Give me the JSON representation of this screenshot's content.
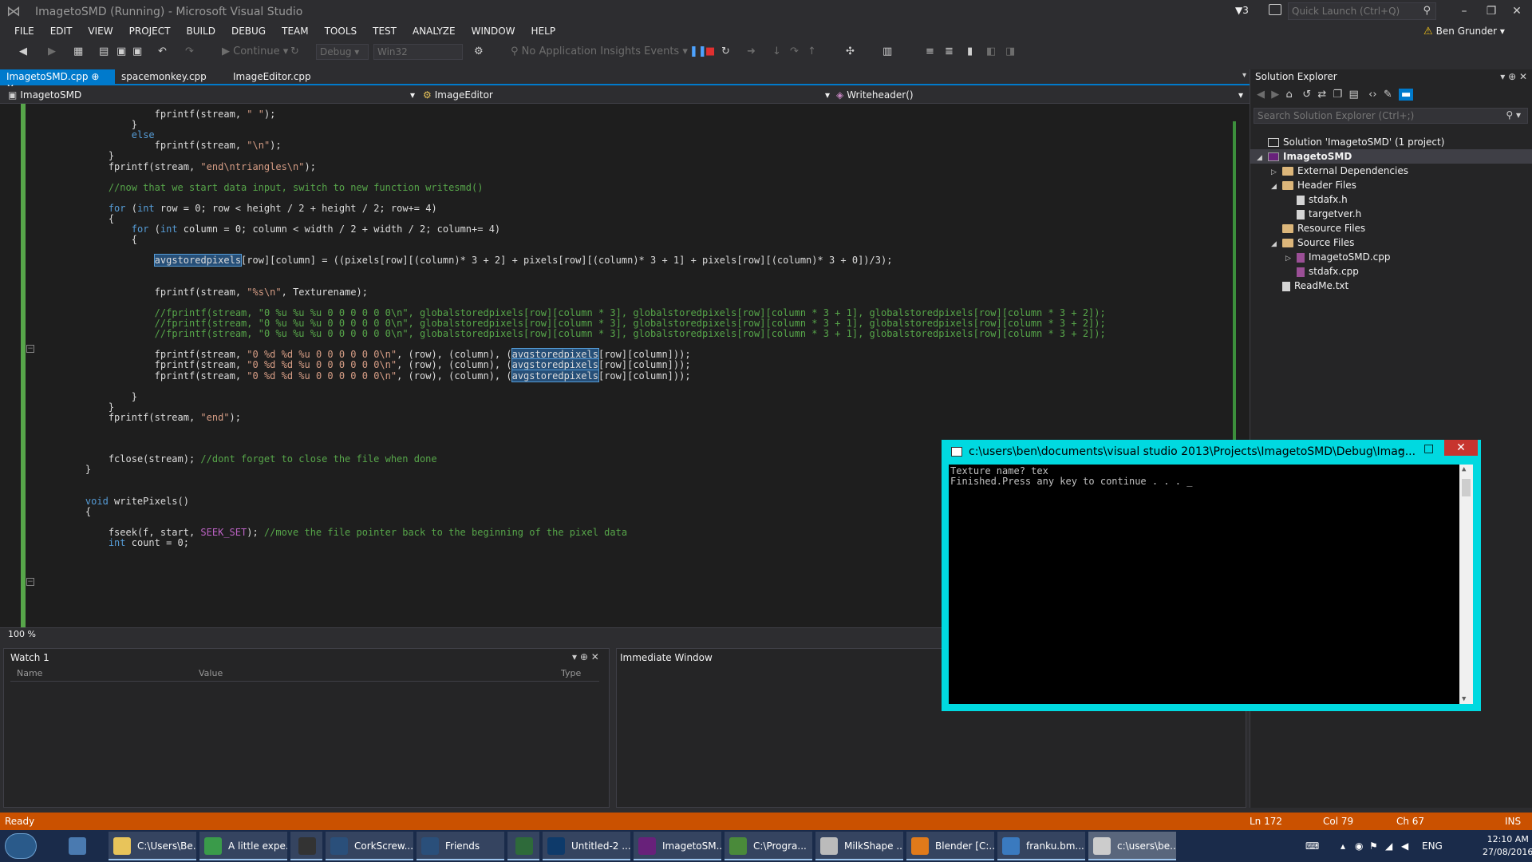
{
  "window": {
    "title": "ImagetoSMD (Running) - Microsoft Visual Studio",
    "filter_count": "3",
    "quick_launch_placeholder": "Quick Launch (Ctrl+Q)",
    "user": "Ben Grunder"
  },
  "menu": [
    "FILE",
    "EDIT",
    "VIEW",
    "PROJECT",
    "BUILD",
    "DEBUG",
    "TEAM",
    "TOOLS",
    "TEST",
    "ANALYZE",
    "WINDOW",
    "HELP"
  ],
  "toolbar": {
    "continue_label": "Continue",
    "config": "Debug",
    "platform": "Win32",
    "insights": "No Application Insights Events"
  },
  "tabs": [
    {
      "label": "ImagetoSMD.cpp",
      "active": true
    },
    {
      "label": "spacemonkey.cpp",
      "active": false
    },
    {
      "label": "ImageEditor.cpp",
      "active": false
    }
  ],
  "navbar": {
    "project": "ImagetoSMD",
    "scope": "ImageEditor",
    "member": "Writeheader()"
  },
  "code_lines": [
    {
      "indent": 8,
      "parts": [
        [
          "",
          "fprintf(stream, "
        ],
        [
          "str",
          "\" \""
        ],
        [
          "",
          ");"
        ]
      ]
    },
    {
      "indent": 4,
      "parts": [
        [
          "",
          "}"
        ]
      ]
    },
    {
      "indent": 4,
      "parts": [
        [
          "kw",
          "else"
        ]
      ]
    },
    {
      "indent": 8,
      "parts": [
        [
          "",
          "fprintf(stream, "
        ],
        [
          "str",
          "\"\\n\""
        ],
        [
          "",
          ");"
        ]
      ]
    },
    {
      "indent": 0,
      "parts": [
        [
          "",
          "}"
        ]
      ]
    },
    {
      "indent": 0,
      "parts": [
        [
          "",
          "fprintf(stream, "
        ],
        [
          "str",
          "\"end\\ntriangles\\n\""
        ],
        [
          "",
          ");"
        ]
      ]
    },
    {
      "indent": 0,
      "parts": []
    },
    {
      "indent": 0,
      "parts": [
        [
          "cm",
          "//now that we start data input, switch to new function writesmd()"
        ]
      ]
    },
    {
      "indent": 0,
      "parts": []
    },
    {
      "indent": 0,
      "parts": [
        [
          "kw",
          "for"
        ],
        [
          "",
          " ("
        ],
        [
          "kw",
          "int"
        ],
        [
          "",
          " row = 0; row < height / 2 + height / 2; row+= 4)"
        ]
      ]
    },
    {
      "indent": 0,
      "parts": [
        [
          "",
          "{"
        ]
      ]
    },
    {
      "indent": 4,
      "parts": [
        [
          "kw",
          "for"
        ],
        [
          "",
          " ("
        ],
        [
          "kw",
          "int"
        ],
        [
          "",
          " column = 0; column < width / 2 + width / 2; column+= 4)"
        ]
      ]
    },
    {
      "indent": 4,
      "parts": [
        [
          "",
          "{"
        ]
      ]
    },
    {
      "indent": 0,
      "parts": []
    },
    {
      "indent": 8,
      "parts": [
        [
          "hl",
          "avgstoredpixels"
        ],
        [
          "",
          "[row][column] = ((pixels[row][(column)* 3 + 2] + pixels[row][(column)* 3 + 1] + pixels[row][(column)* 3 + 0])/3);"
        ]
      ]
    },
    {
      "indent": 0,
      "parts": []
    },
    {
      "indent": 0,
      "parts": []
    },
    {
      "indent": 8,
      "parts": [
        [
          "",
          "fprintf(stream, "
        ],
        [
          "str",
          "\"%s\\n\""
        ],
        [
          "",
          ", Texturename);"
        ]
      ]
    },
    {
      "indent": 0,
      "parts": []
    },
    {
      "indent": 8,
      "parts": [
        [
          "cm",
          "//fprintf(stream, \"0 %u %u %u 0 0 0 0 0 0\\n\", globalstoredpixels[row][column * 3], globalstoredpixels[row][column * 3 + 1], globalstoredpixels[row][column * 3 + 2]);"
        ]
      ]
    },
    {
      "indent": 8,
      "parts": [
        [
          "cm",
          "//fprintf(stream, \"0 %u %u %u 0 0 0 0 0 0\\n\", globalstoredpixels[row][column * 3], globalstoredpixels[row][column * 3 + 1], globalstoredpixels[row][column * 3 + 2]);"
        ]
      ]
    },
    {
      "indent": 8,
      "parts": [
        [
          "cm",
          "//fprintf(stream, \"0 %u %u %u 0 0 0 0 0 0\\n\", globalstoredpixels[row][column * 3], globalstoredpixels[row][column * 3 + 1], globalstoredpixels[row][column * 3 + 2]);"
        ]
      ]
    },
    {
      "indent": 0,
      "parts": []
    },
    {
      "indent": 8,
      "parts": [
        [
          "",
          "fprintf(stream, "
        ],
        [
          "str",
          "\"0 %d %d %u 0 0 0 0 0 0\\n\""
        ],
        [
          "",
          ", (row), (column), ("
        ],
        [
          "hl",
          "avgstoredpixels"
        ],
        [
          "",
          "[row][column]));"
        ]
      ]
    },
    {
      "indent": 8,
      "parts": [
        [
          "",
          "fprintf(stream, "
        ],
        [
          "str",
          "\"0 %d %d %u 0 0 0 0 0 0\\n\""
        ],
        [
          "",
          ", (row), (column), ("
        ],
        [
          "hl",
          "avgstoredpixels"
        ],
        [
          "",
          "[row][column]));"
        ]
      ]
    },
    {
      "indent": 8,
      "parts": [
        [
          "",
          "fprintf(stream, "
        ],
        [
          "str",
          "\"0 %d %d %u 0 0 0 0 0 0\\n\""
        ],
        [
          "",
          ", (row), (column), ("
        ],
        [
          "hl",
          "avgstoredpixels"
        ],
        [
          "",
          "[row][column]));"
        ]
      ]
    },
    {
      "indent": 0,
      "parts": []
    },
    {
      "indent": 4,
      "parts": [
        [
          "",
          "}"
        ]
      ]
    },
    {
      "indent": 0,
      "parts": [
        [
          "",
          "}"
        ]
      ]
    },
    {
      "indent": 0,
      "parts": [
        [
          "",
          "fprintf(stream, "
        ],
        [
          "str",
          "\"end\""
        ],
        [
          "",
          ");"
        ]
      ]
    },
    {
      "indent": 0,
      "parts": []
    },
    {
      "indent": 0,
      "parts": []
    },
    {
      "indent": 0,
      "parts": []
    },
    {
      "indent": 0,
      "parts": [
        [
          "",
          "fclose(stream); "
        ],
        [
          "cm",
          "//dont forget to close the file when done"
        ]
      ]
    },
    {
      "indent": -4,
      "parts": [
        [
          "",
          "}"
        ]
      ]
    },
    {
      "indent": 0,
      "parts": []
    },
    {
      "indent": 0,
      "parts": []
    },
    {
      "indent": -4,
      "parts": [
        [
          "kw",
          "void"
        ],
        [
          "",
          " writePixels()"
        ]
      ]
    },
    {
      "indent": -4,
      "parts": [
        [
          "",
          "{"
        ]
      ]
    },
    {
      "indent": 0,
      "parts": []
    },
    {
      "indent": 0,
      "parts": [
        [
          "",
          "fseek(f, start, "
        ],
        [
          "mac",
          "SEEK_SET"
        ],
        [
          "",
          "); "
        ],
        [
          "cm",
          "//move the file pointer back to the beginning of the pixel data"
        ]
      ]
    },
    {
      "indent": 0,
      "parts": [
        [
          "kw",
          "int"
        ],
        [
          "",
          " count = 0;"
        ]
      ]
    }
  ],
  "zoom": "100 %",
  "watch": {
    "title": "Watch 1",
    "columns": [
      "Name",
      "Value",
      "Type"
    ]
  },
  "immediate": {
    "title": "Immediate Window"
  },
  "solution_explorer": {
    "title": "Solution Explorer",
    "search_placeholder": "Search Solution Explorer (Ctrl+;)",
    "items": [
      {
        "label": "Solution 'ImagetoSMD' (1 project)",
        "level": 0,
        "arrow": "",
        "icon": "sln"
      },
      {
        "label": "ImagetoSMD",
        "level": 0,
        "arrow": "◢",
        "icon": "proj",
        "selected": true
      },
      {
        "label": "External Dependencies",
        "level": 1,
        "arrow": "▷",
        "icon": "folder"
      },
      {
        "label": "Header Files",
        "level": 1,
        "arrow": "◢",
        "icon": "folder"
      },
      {
        "label": "stdafx.h",
        "level": 2,
        "arrow": "",
        "icon": "file"
      },
      {
        "label": "targetver.h",
        "level": 2,
        "arrow": "",
        "icon": "file"
      },
      {
        "label": "Resource Files",
        "level": 1,
        "arrow": "",
        "icon": "folder"
      },
      {
        "label": "Source Files",
        "level": 1,
        "arrow": "◢",
        "icon": "folder"
      },
      {
        "label": "ImagetoSMD.cpp",
        "level": 2,
        "arrow": "▷",
        "icon": "cppfile"
      },
      {
        "label": "stdafx.cpp",
        "level": 2,
        "arrow": "",
        "icon": "cppfile"
      },
      {
        "label": "ReadMe.txt",
        "level": 1,
        "arrow": "",
        "icon": "file"
      }
    ]
  },
  "console": {
    "title": "c:\\users\\ben\\documents\\visual studio 2013\\Projects\\ImagetoSMD\\Debug\\Imag...",
    "lines": [
      "Texture name? tex",
      "Finished.Press any key to continue . . . _"
    ]
  },
  "status": {
    "text": "Ready",
    "line": "Ln 172",
    "col": "Col 79",
    "ch": "Ch 67",
    "mode": "INS"
  },
  "taskbar": {
    "tasks": [
      {
        "label": "C:\\Users\\Be...",
        "color": "#e8c45a"
      },
      {
        "label": "A little expe...",
        "color": "#3a9b4a"
      },
      {
        "label": "",
        "color": "#333333"
      },
      {
        "label": "CorkScrew...",
        "color": "#2a4f7a"
      },
      {
        "label": "Friends",
        "color": "#2a4f7a"
      },
      {
        "label": "",
        "color": "#2e6a3a"
      },
      {
        "label": "Untitled-2 ...",
        "color": "#0e3a6a"
      },
      {
        "label": "ImagetoSM...",
        "color": "#68217a"
      },
      {
        "label": "C:\\Progra...",
        "color": "#4a8a3a"
      },
      {
        "label": "MilkShape ...",
        "color": "#bbbbbb"
      },
      {
        "label": "Blender [C:...",
        "color": "#e07a1a"
      },
      {
        "label": "franku.bm...",
        "color": "#3a7abf"
      },
      {
        "label": "c:\\users\\be...",
        "color": "#cccccc"
      }
    ],
    "lang": "ENG",
    "time": "12:10 AM",
    "date": "27/08/2016"
  }
}
